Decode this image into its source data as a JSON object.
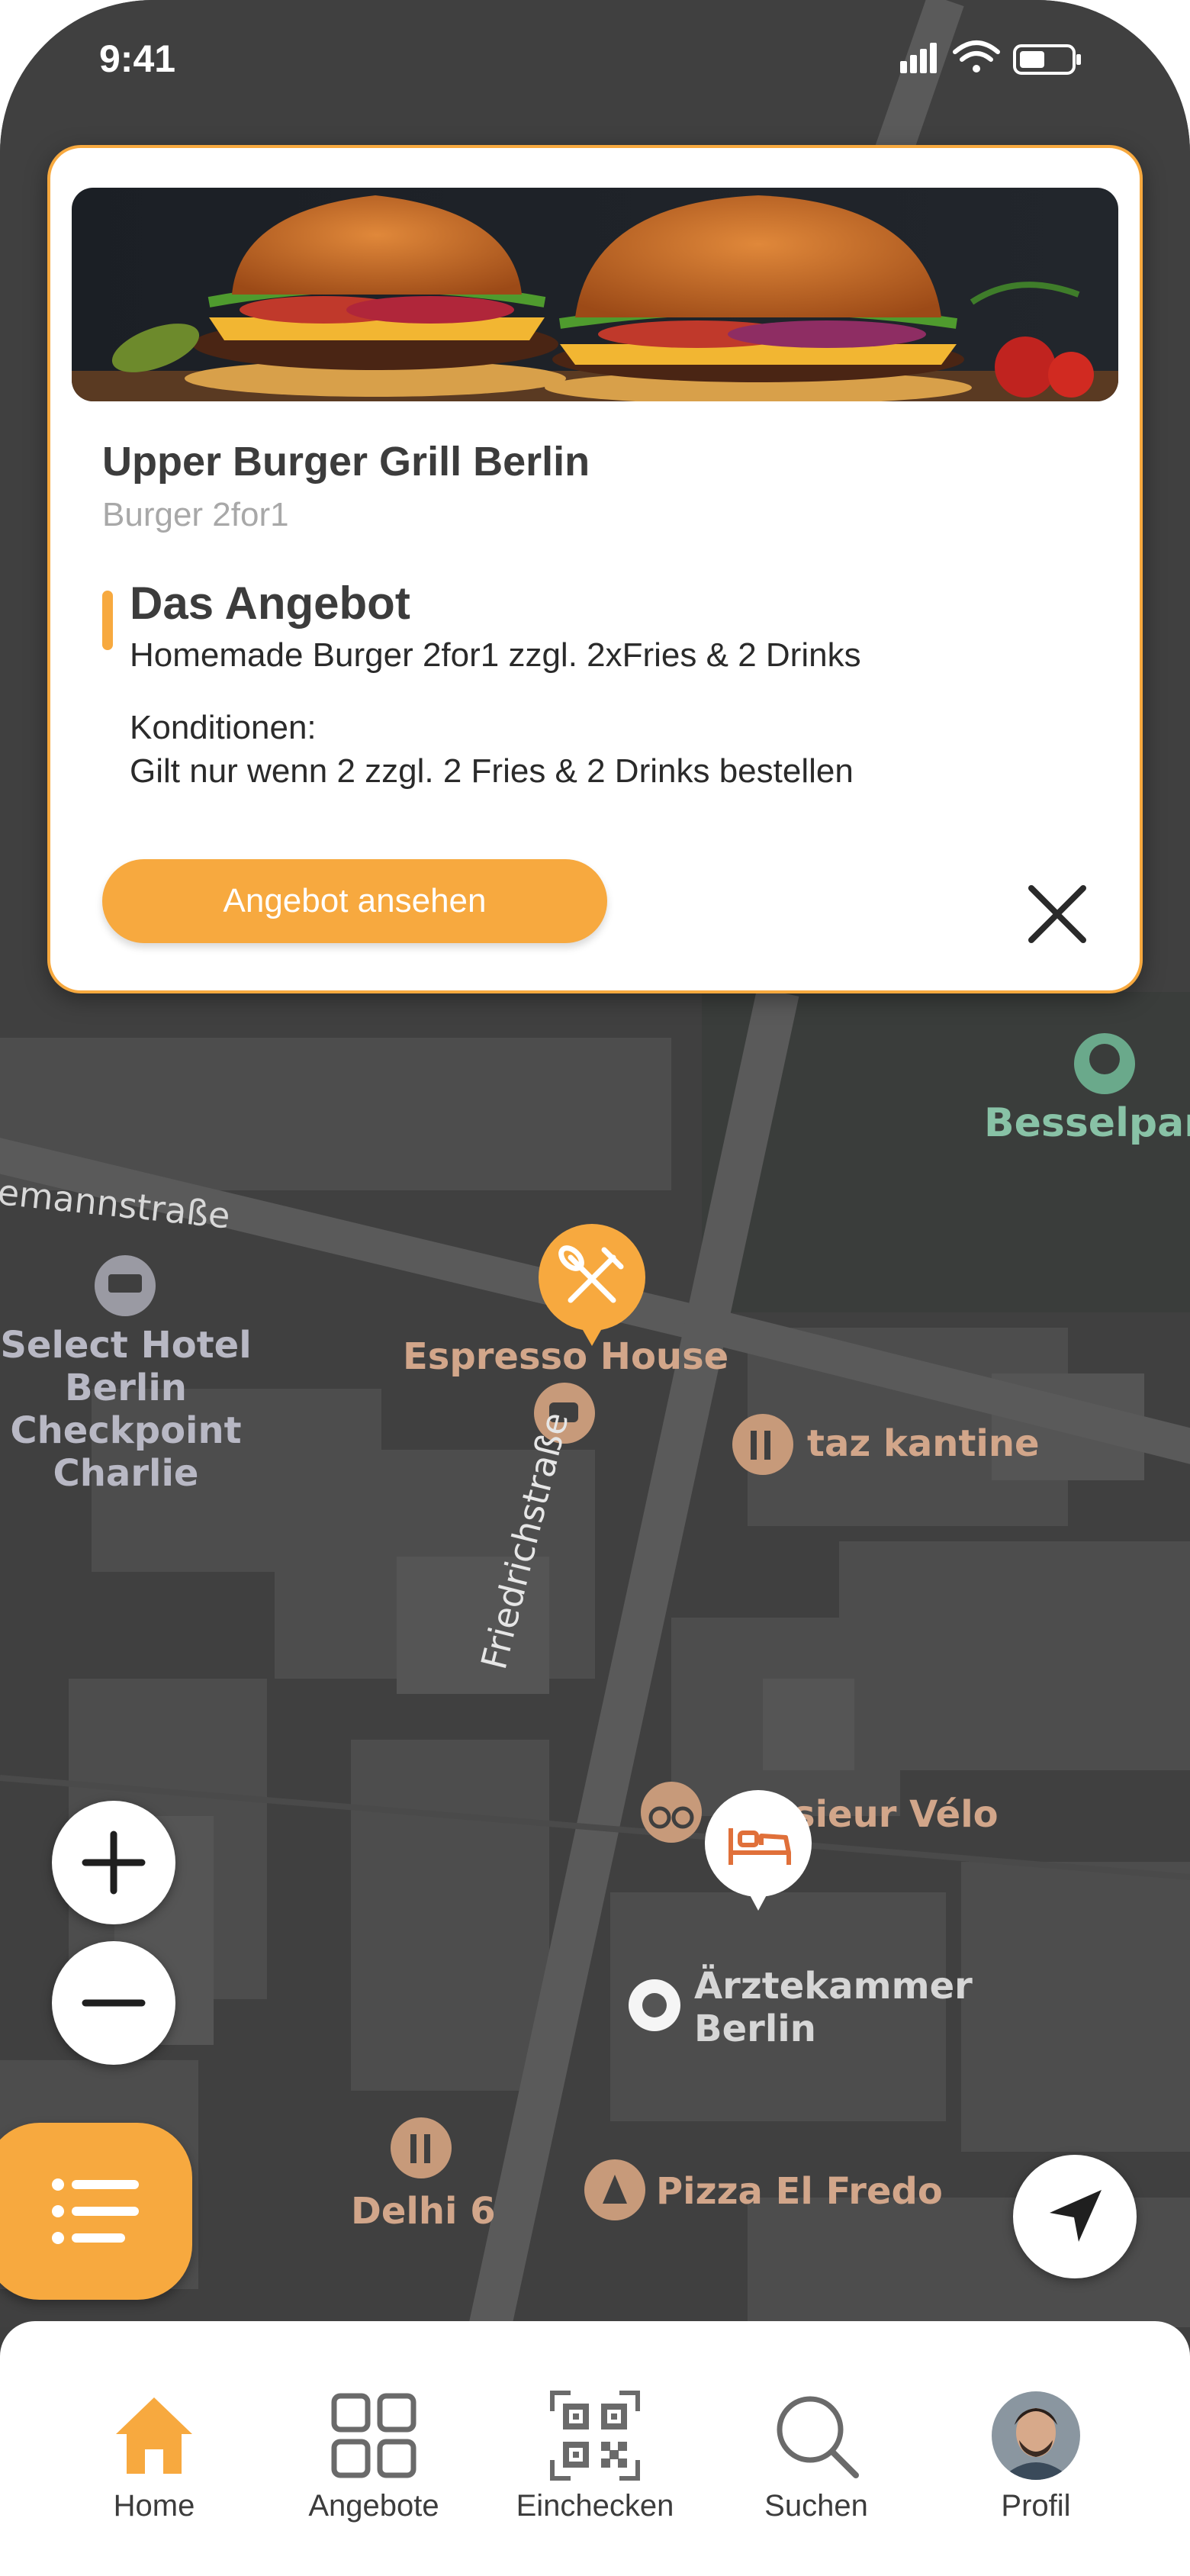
{
  "status_bar": {
    "time": "9:41"
  },
  "map": {
    "street_friedrichstrasse": "Friedrichstraße",
    "street_top": "emannstraße",
    "labels": {
      "select_hotel": "Select Hotel\nBerlin\nCheckpoint\nCharlie",
      "espresso_house": "Espresso House",
      "taz_kantine": "taz kantine",
      "besselpark": "Besselpar",
      "monsieur_velo": "sieur Vélo",
      "aerztekammer": "Ärztekammer\nBerlin",
      "delhi6": "Delhi 6",
      "pizza": "Pizza El Fredo"
    },
    "colors": {
      "background": "#3f3f3f",
      "buildings": "#555555",
      "accent": "#f7a93f"
    }
  },
  "offer_card": {
    "title": "Upper Burger Grill Berlin",
    "subtitle": "Burger 2for1",
    "offer_heading": "Das Angebot",
    "offer_text": "Homemade Burger 2for1 zzgl. 2xFries & 2 Drinks",
    "conditions_heading": "Konditionen:",
    "conditions_text": "Gilt nur wenn 2 zzgl. 2 Fries & 2 Drinks bestellen",
    "cta_label": "Angebot ansehen"
  },
  "bottom_nav": {
    "items": [
      {
        "label": "Home",
        "icon": "home-icon",
        "active": true
      },
      {
        "label": "Angebote",
        "icon": "grid-icon",
        "active": false
      },
      {
        "label": "Einchecken",
        "icon": "qr-code-icon",
        "active": false
      },
      {
        "label": "Suchen",
        "icon": "search-icon",
        "active": false
      },
      {
        "label": "Profil",
        "icon": "avatar",
        "active": false
      }
    ]
  }
}
